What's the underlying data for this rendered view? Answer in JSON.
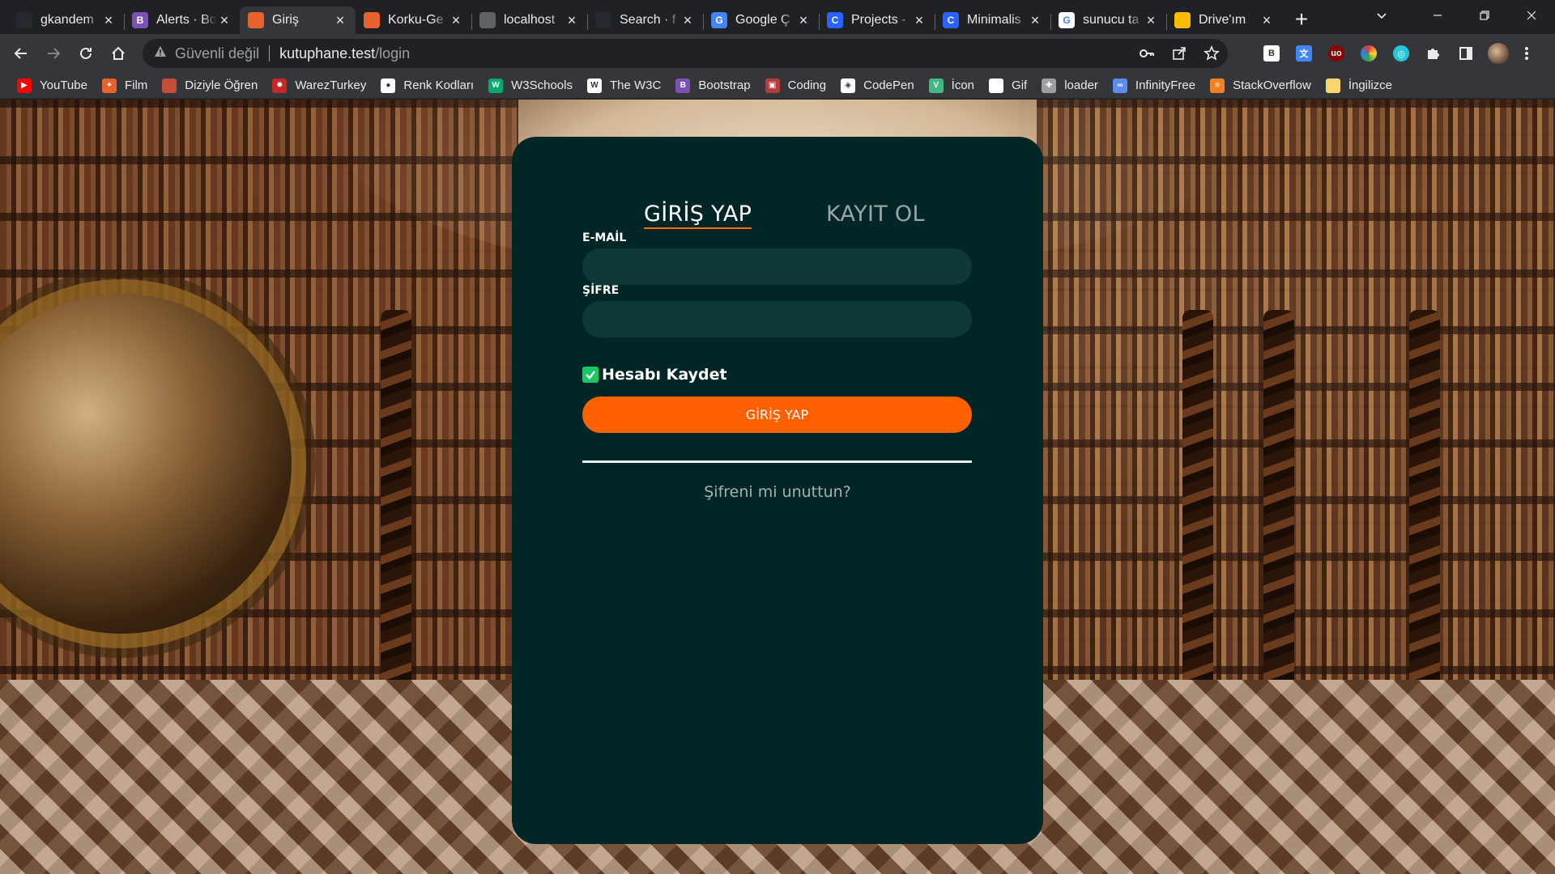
{
  "browser": {
    "tabs": [
      {
        "title": "gkandem",
        "favicon": "github-icon",
        "color": "#24292f",
        "glyph": ""
      },
      {
        "title": "Alerts · Bo",
        "favicon": "bootstrap-icon",
        "color": "#7952b3",
        "glyph": "B"
      },
      {
        "title": "Giriş",
        "favicon": "page-icon",
        "color": "#e8632b",
        "glyph": ""
      },
      {
        "title": "Korku-Ge",
        "favicon": "page-icon",
        "color": "#e8632b",
        "glyph": ""
      },
      {
        "title": "localhost",
        "favicon": "localhost-icon",
        "color": "#5f6368",
        "glyph": ""
      },
      {
        "title": "Search · f",
        "favicon": "github-icon",
        "color": "#24292f",
        "glyph": ""
      },
      {
        "title": "Google Ç",
        "favicon": "translate-icon",
        "color": "#4285f4",
        "glyph": "G"
      },
      {
        "title": "Projects -",
        "favicon": "project-icon",
        "color": "#2962ff",
        "glyph": "C"
      },
      {
        "title": "Minimalis",
        "favicon": "project-icon",
        "color": "#2962ff",
        "glyph": "C"
      },
      {
        "title": "sunucu ta",
        "favicon": "google-icon",
        "color": "#ffffff",
        "glyph": "G"
      },
      {
        "title": "Drive'ım",
        "favicon": "drive-icon",
        "color": "#fbbc04",
        "glyph": ""
      }
    ],
    "active_tab": 2,
    "address": {
      "security": "Güvenli değil",
      "host": "kutuphane.test",
      "path": "/login"
    },
    "bookmarks": [
      {
        "label": "YouTube",
        "icon": "youtube-icon",
        "color": "#ff0000",
        "glyph": "▶"
      },
      {
        "label": "Film",
        "icon": "film-icon",
        "color": "#e8632b",
        "glyph": "✦"
      },
      {
        "label": "Diziyle Öğren",
        "icon": "cup-icon",
        "color": "#c44d3a",
        "glyph": ""
      },
      {
        "label": "WarezTurkey",
        "icon": "gear-icon",
        "color": "#c62828",
        "glyph": "✹"
      },
      {
        "label": "Renk Kodları",
        "icon": "color-icon",
        "color": "#ffffff",
        "glyph": "●"
      },
      {
        "label": "W3Schools",
        "icon": "w3schools-icon",
        "color": "#04aa6d",
        "glyph": "W"
      },
      {
        "label": "The W3C",
        "icon": "w3c-icon",
        "color": "#ffffff",
        "glyph": "W"
      },
      {
        "label": "Bootstrap",
        "icon": "bootstrap-icon",
        "color": "#7952b3",
        "glyph": "B"
      },
      {
        "label": "Coding",
        "icon": "coding-icon",
        "color": "#b53c3c",
        "glyph": "▣"
      },
      {
        "label": "CodePen",
        "icon": "codepen-icon",
        "color": "#ffffff",
        "glyph": "◈"
      },
      {
        "label": "İcon",
        "icon": "vue-icon",
        "color": "#41b883",
        "glyph": "V"
      },
      {
        "label": "Gif",
        "icon": "file-icon",
        "color": "#ffffff",
        "glyph": ""
      },
      {
        "label": "loader",
        "icon": "loader-icon",
        "color": "#9e9e9e",
        "glyph": "✚"
      },
      {
        "label": "InfinityFree",
        "icon": "infinity-icon",
        "color": "#5b8def",
        "glyph": "∞"
      },
      {
        "label": "StackOverflow",
        "icon": "stackoverflow-icon",
        "color": "#f48024",
        "glyph": "≡"
      },
      {
        "label": "İngilizce",
        "icon": "folder-icon",
        "color": "#f9d56e",
        "glyph": ""
      }
    ]
  },
  "login": {
    "tab_login": "GİRİŞ YAP",
    "tab_register": "KAYIT OL",
    "email_label": "E-MAİL",
    "email_value": "",
    "password_label": "ŞİFRE",
    "password_value": "",
    "remember_label": "Hesabı Kaydet",
    "remember_checked": true,
    "submit_label": "GİRİŞ YAP",
    "forgot_link": "Şifreni mi unuttun?"
  },
  "colors": {
    "card_bg": "#022626",
    "field_bg": "#0f3939",
    "accent": "#ff6000",
    "checkbox": "#17c964"
  }
}
